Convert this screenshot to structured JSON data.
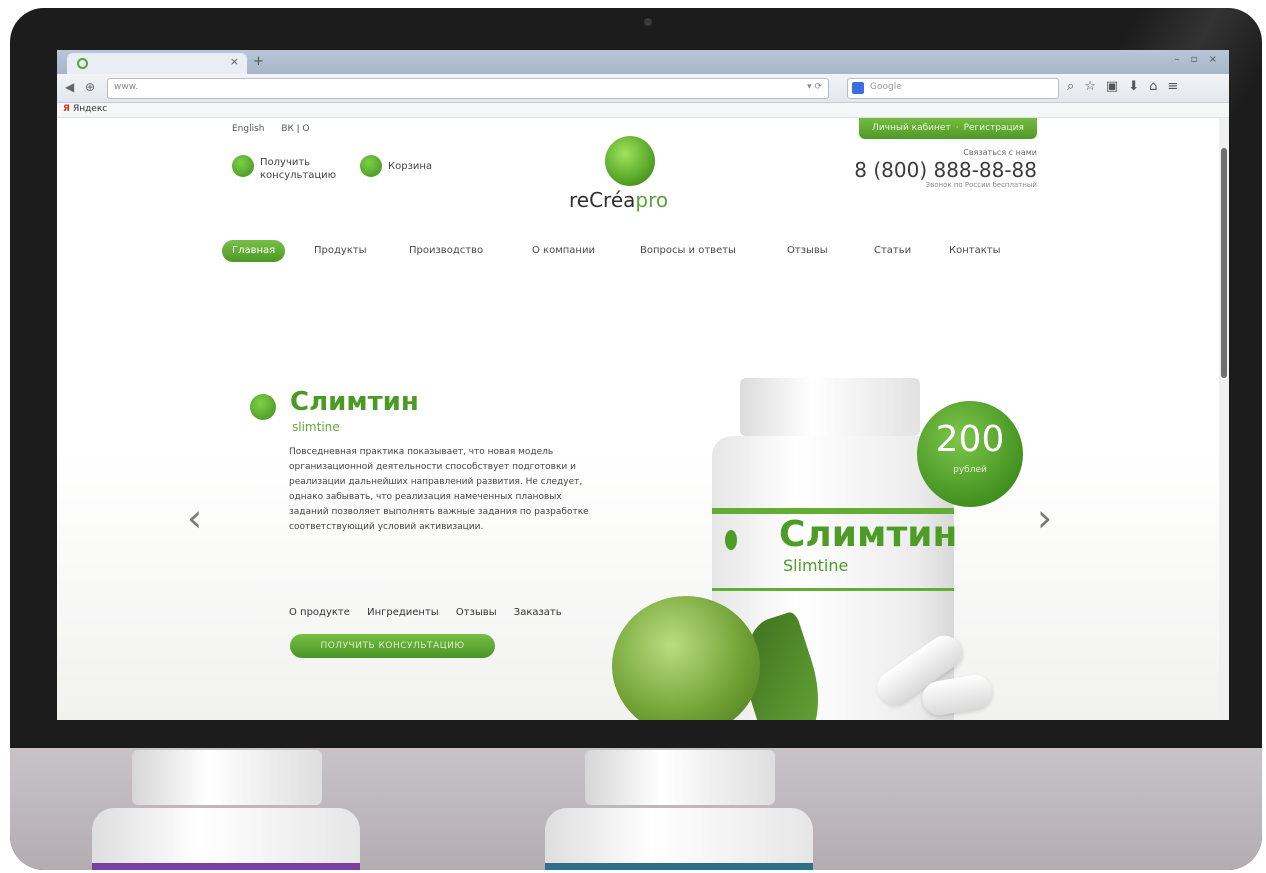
{
  "browser": {
    "tab_close": "×",
    "new_tab": "+",
    "url": "www.",
    "search_placeholder": "Google",
    "bookmark": "Яндекс"
  },
  "site": {
    "lang": {
      "english": "English",
      "icons": "ВК  ǀ  О"
    },
    "cabinet": {
      "login": "Личный кабинет",
      "register": "Регистрация"
    },
    "header": {
      "consult": "Получить консультацию",
      "cart": "Корзина",
      "logo_main": "reCréa",
      "logo_suffix": "pro",
      "phone_caption": "Связаться с нами",
      "phone": "8 (800) 888-88-88",
      "phone_note": "Звонок по России бесплатный"
    },
    "menu": [
      {
        "label": "Главная"
      },
      {
        "label": "Продукты"
      },
      {
        "label": "Производство"
      },
      {
        "label": "О компании"
      },
      {
        "label": "Вопросы и ответы"
      },
      {
        "label": "Отзывы"
      },
      {
        "label": "Статьи"
      },
      {
        "label": "Контакты"
      }
    ],
    "slide": {
      "title": "Слимтин",
      "subtitle": "slimtine",
      "description": "Повседневная практика показывает, что новая модель организационной деятельности способствует подготовки и реализации дальнейших направлений развития. Не следует, однако забывать, что реализация намеченных плановых заданий позволяет выполнять важные задания по разработке соответствующий условий активизации.",
      "tabs": [
        "О продукте",
        "Ингредиенты",
        "Отзывы",
        "Заказать"
      ],
      "cta": "ПОЛУЧИТЬ КОНСУЛЬТАЦИЮ",
      "prev": "‹",
      "next": "›",
      "pager": "● ● ●"
    },
    "product": {
      "title": "Слимтин",
      "subtitle": "Slimtine",
      "price": "200",
      "currency": "рублей"
    }
  },
  "colors": {
    "accent": "#4c9c26",
    "bezel": "#1c1c1c",
    "bottle_band_left": "#7a3fa0",
    "bottle_band_right": "#2f6f8a"
  }
}
